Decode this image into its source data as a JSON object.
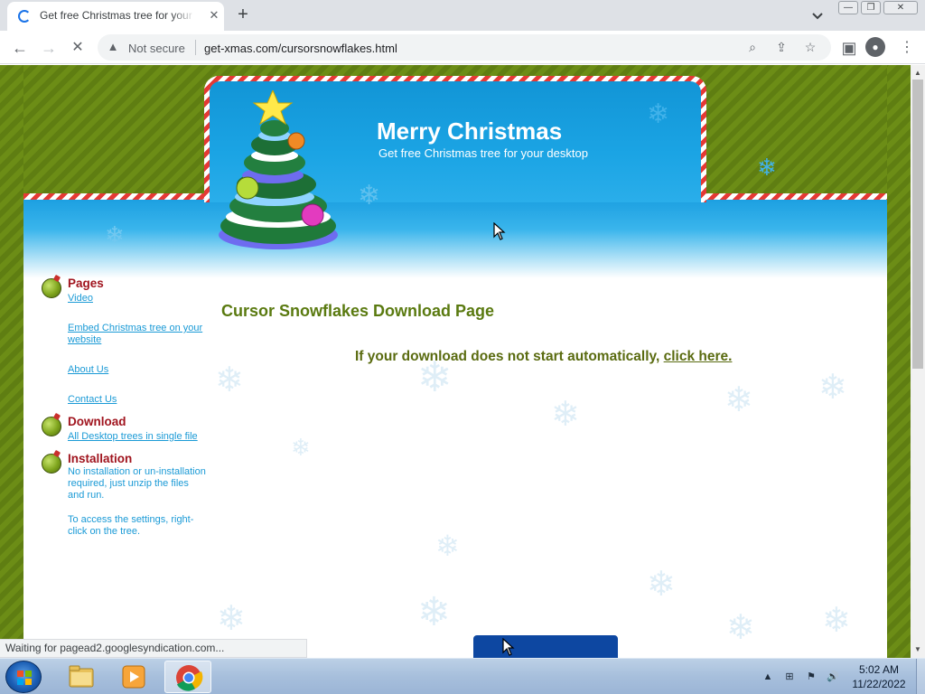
{
  "browser": {
    "tab_title": "Get free Christmas tree for your desktop",
    "tab_close": "✕",
    "new_tab": "+",
    "security_label": "Not secure",
    "url": "get-xmas.com/cursorsnowflakes.html",
    "status_text": "Waiting for pagead2.googlesyndication.com..."
  },
  "header": {
    "title": "Merry Christmas",
    "subtitle": "Get free Christmas tree for your desktop"
  },
  "sidebar": {
    "pages": {
      "title": "Pages",
      "links": [
        "Video",
        "Embed Christmas tree on your website",
        "About Us",
        "Contact Us"
      ]
    },
    "download": {
      "title": "Download",
      "links": [
        "All Desktop trees in single file"
      ]
    },
    "installation": {
      "title": "Installation",
      "text": [
        "No installation or un-installation required, just unzip the files and run.",
        "To access the settings, right-click on the tree."
      ]
    }
  },
  "content": {
    "heading": "Cursor Snowflakes Download Page",
    "download_prefix": "If your download does not start automatically, ",
    "click_here": "click here."
  },
  "taskbar": {
    "time": "5:02 AM",
    "date": "11/22/2022"
  },
  "colors": {
    "page_green": "#6b8b16",
    "sky_blue": "#1ba4e4",
    "candy_red": "#e53935",
    "heading_green": "#5a7a10",
    "link_blue": "#1a9ad6",
    "section_red": "#a0141e"
  },
  "icons": [
    "loading-spinner-icon",
    "close-icon",
    "plus-icon",
    "chevron-down-icon",
    "back-arrow-icon",
    "forward-arrow-icon",
    "stop-icon",
    "warning-icon",
    "zoom-icon",
    "share-icon",
    "star-icon",
    "side-panel-icon",
    "profile-icon",
    "kebab-menu-icon",
    "windows-logo-icon",
    "folder-icon",
    "media-player-icon",
    "chrome-icon"
  ]
}
